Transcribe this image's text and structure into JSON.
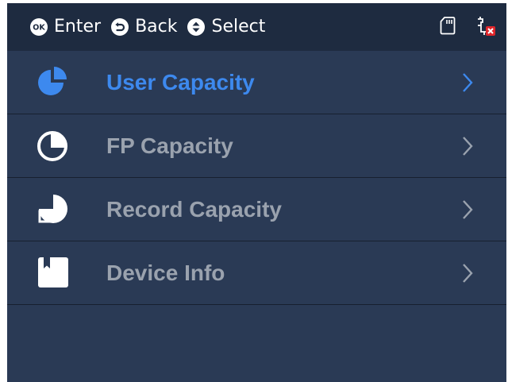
{
  "header": {
    "hints": [
      {
        "icon": "ok-button-icon",
        "label": "Enter"
      },
      {
        "icon": "back-arrow-icon",
        "label": "Back"
      },
      {
        "icon": "up-down-select-icon",
        "label": "Select"
      }
    ],
    "status_icons": [
      "sd-card-icon",
      "network-disconnected-icon"
    ]
  },
  "menu": {
    "items": [
      {
        "label": "User Capacity",
        "icon": "pie-chart-filled-icon",
        "selected": true
      },
      {
        "label": "FP Capacity",
        "icon": "pie-chart-outline-icon",
        "selected": false
      },
      {
        "label": "Record Capacity",
        "icon": "record-disc-icon",
        "selected": false
      },
      {
        "label": "Device Info",
        "icon": "bookmark-card-icon",
        "selected": false
      }
    ]
  },
  "colors": {
    "screen_background": "#2a3a55",
    "header_background": "#1e2b40",
    "row_divider": "#17202f",
    "selected_accent": "#3d89ee",
    "normal_text": "#9aa2ae",
    "icon_white": "#ffffff",
    "error_red": "#e0262b"
  }
}
